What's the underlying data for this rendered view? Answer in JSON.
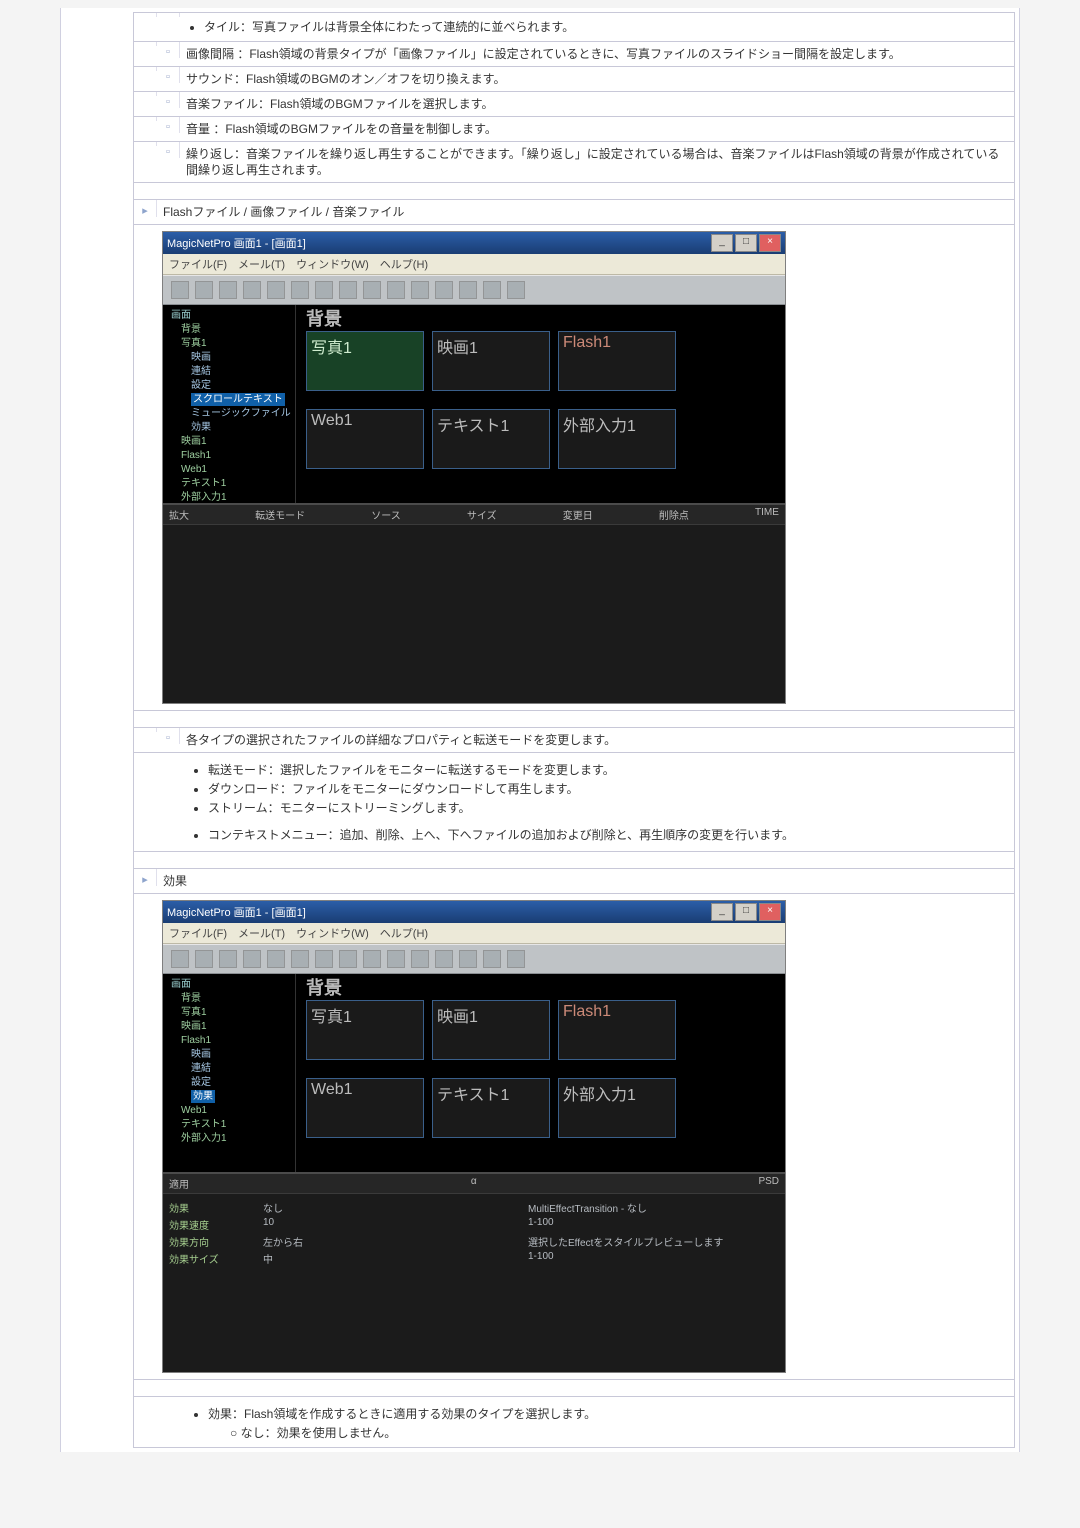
{
  "intro_bullet": "タイル：写真ファイルは背景全体にわたって連続的に並べられます。",
  "rows": {
    "r1": "画像間隔 ：Flash領域の背景タイプが「画像ファイル」に設定されているときに、写真ファイルのスライドショー間隔を設定します。",
    "r2": "サウンド：Flash領域のBGMのオン／オフを切り換えます。",
    "r3": "音楽ファイル：Flash領域のBGMファイルを選択します。",
    "r4": "音量 ：Flash領域のBGMファイルをの音量を制御します。",
    "r5": "繰り返し：音楽ファイルを繰り返し再生することができます。「繰り返し」に設定されている場合は、音楽ファイルはFlash領域の背景が作成されている間繰り返し再生されます。"
  },
  "heading_files": "Flashファイル / 画像ファイル / 音楽ファイル",
  "app_title": "MagicNetPro 画面1 - [画面1]",
  "menubar": "ファイル(F)　メール(T)　ウィンドウ(W)　ヘルプ(H)",
  "tree": {
    "root": "画面",
    "items": [
      "背景",
      "写真1",
      "映画",
      "連結",
      "設定",
      "スクロールテキスト",
      "ミュージックファイル",
      "効果"
    ],
    "others": [
      "映画1",
      "Flash1",
      "Web1",
      "テキスト1",
      "外部入力1"
    ]
  },
  "canvas": {
    "heading": "背景",
    "photo": "写真1",
    "movie": "映画1",
    "flash": "Flash1",
    "web": "Web1",
    "text": "テキスト1",
    "ext": "外部入力1"
  },
  "panel1": {
    "cols": [
      "拡大",
      "転送モード",
      "ソース",
      "サイズ",
      "変更日",
      "削除点",
      "TIME"
    ]
  },
  "row_below_shot1": "各タイプの選択されたファイルの詳細なプロパティと転送モードを変更します。",
  "bullets2": {
    "b1": "転送モード：選択したファイルをモニターに転送するモードを変更します。",
    "b2": "ダウンロード：ファイルをモニターにダウンロードして再生します。",
    "b3": "ストリーム：モニターにストリーミングします。",
    "b4": "コンテキストメニュー：追加、削除、上へ、下へファイルの追加および削除と、再生順序の変更を行います。"
  },
  "heading_effect": "効果",
  "panel2": {
    "rows": [
      {
        "l": "適用",
        "c": "α",
        "r": "PSD"
      },
      {
        "l": "効果",
        "c": "なし",
        "r": "MultiEffectTransition - なし"
      },
      {
        "l": "効果速度",
        "c": "10",
        "r": "1-100"
      },
      {
        "l": "効果方向",
        "c": "左から右",
        "r": "選択したEffectをスタイルプレビューします"
      },
      {
        "l": "効果サイズ",
        "c": "中",
        "r": "1-100"
      }
    ]
  },
  "effect_bullet": "効果：Flash領域を作成するときに適用する効果のタイプを選択します。",
  "effect_sub": "○ なし：効果を使用しません。"
}
